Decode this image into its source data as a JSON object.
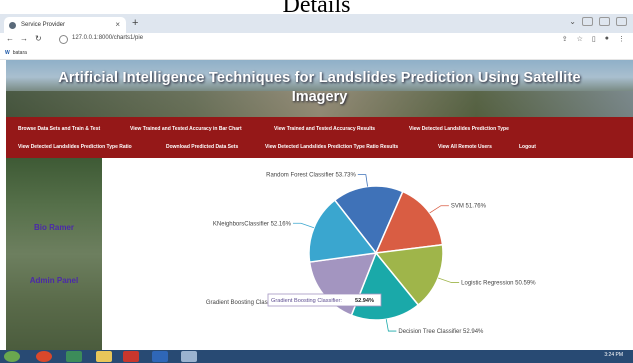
{
  "document": {
    "heading": "Details"
  },
  "browser": {
    "tab_title": "Service Provider",
    "tab_close": "×",
    "new_tab": "+",
    "url": "127.0.0.1:8000/charts1/pie",
    "bookmark_label": "batara"
  },
  "header": {
    "title_line1": "Artificial Intelligence Techniques for Landslides Prediction Using Satellite",
    "title_line2": "Imagery"
  },
  "menu": {
    "row1": [
      "Browse Data Sets and Train & Test",
      "View Trained and Tested Accuracy in Bar Chart",
      "View Trained and Tested Accuracy Results",
      "View Detected Landslides Prediction Type"
    ],
    "row2": [
      "View Detected Landslides Prediction Type Ratio",
      "Download Predicted Data Sets",
      "View Detected Landslides Prediction Type Ratio Results",
      "View All Remote Users",
      "Logout"
    ]
  },
  "sidebar": {
    "labels": [
      "Bio Ramer",
      "Admin Panel"
    ]
  },
  "chart_data": {
    "type": "pie",
    "slices": [
      {
        "label": "Random Forest Classifier",
        "value": 53.73,
        "color": "#3f72b8"
      },
      {
        "label": "SVM",
        "value": 51.76,
        "color": "#d95d43"
      },
      {
        "label": "Logistic Regression",
        "value": 50.59,
        "color": "#9fb54a"
      },
      {
        "label": "Decision Tree Classifier",
        "value": 52.94,
        "color": "#1aa9a9"
      },
      {
        "label": "Gradient Boosting Classifier",
        "value": 52.94,
        "color": "#a395c0"
      },
      {
        "label": "KNeighborsClassifier",
        "value": 52.16,
        "color": "#3aa6cf"
      }
    ],
    "tooltip": {
      "label": "Gradient Boosting Classifier",
      "value": "52.94%"
    }
  },
  "taskbar": {
    "clock": "3:24 PM"
  }
}
